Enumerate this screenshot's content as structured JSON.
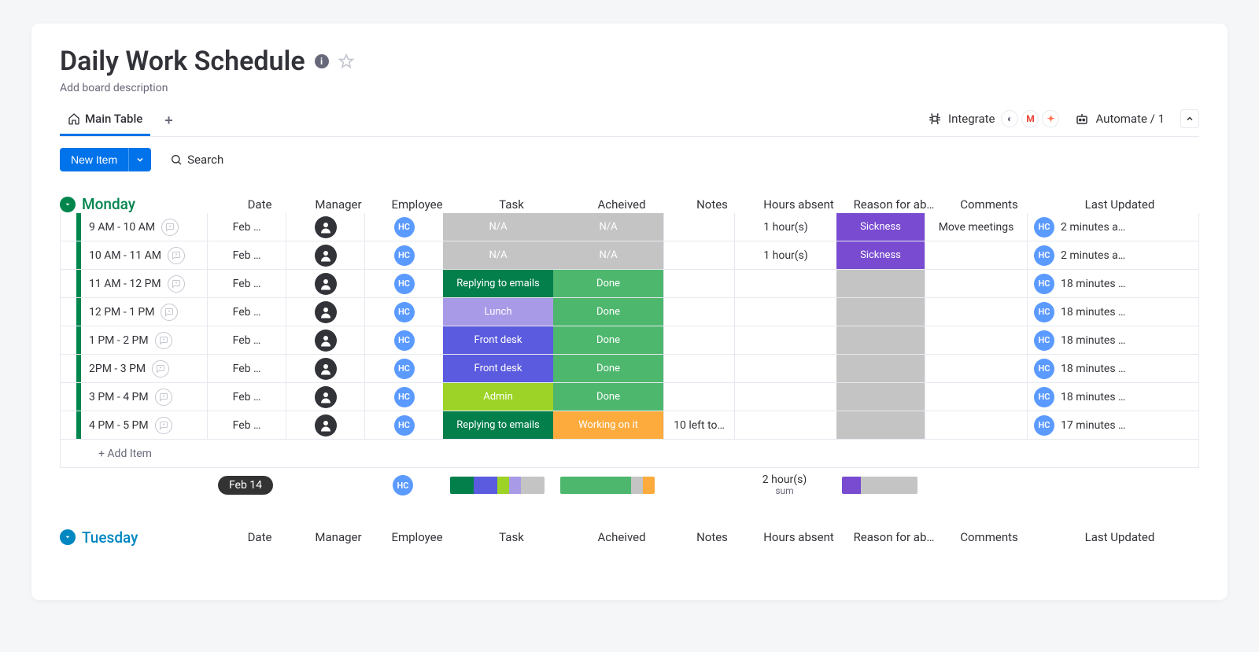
{
  "header": {
    "title": "Daily Work Schedule",
    "description": "Add board description"
  },
  "tabs": {
    "main": "Main Table",
    "integrate": "Integrate",
    "automate": "Automate / 1"
  },
  "toolbar": {
    "new_item": "New Item",
    "search": "Search"
  },
  "columns": [
    "Date",
    "Manager",
    "Employee",
    "Task",
    "Acheived",
    "Notes",
    "Hours absent",
    "Reason for ab…",
    "Comments",
    "Last Updated"
  ],
  "groups": [
    {
      "name": "Monday",
      "color": "#00854d",
      "rows": [
        {
          "name": "9 AM - 10 AM",
          "date": "Feb …",
          "task": {
            "label": "N/A",
            "color": "#c4c4c4"
          },
          "ach": {
            "label": "N/A",
            "color": "#c4c4c4"
          },
          "notes": "",
          "hours": "1 hour(s)",
          "reason": {
            "label": "Sickness",
            "color": "#784bd1"
          },
          "comments": "Move meetings",
          "updated": "2 minutes a…"
        },
        {
          "name": "10 AM - 11 AM",
          "date": "Feb …",
          "task": {
            "label": "N/A",
            "color": "#c4c4c4"
          },
          "ach": {
            "label": "N/A",
            "color": "#c4c4c4"
          },
          "notes": "",
          "hours": "1 hour(s)",
          "reason": {
            "label": "Sickness",
            "color": "#784bd1"
          },
          "comments": "",
          "updated": "2 minutes a…"
        },
        {
          "name": "11 AM - 12 PM",
          "date": "Feb …",
          "task": {
            "label": "Replying to emails",
            "color": "#037f4c"
          },
          "ach": {
            "label": "Done",
            "color": "#4eb76e"
          },
          "notes": "",
          "hours": "",
          "reason": {
            "label": "",
            "color": "#c4c4c4"
          },
          "comments": "",
          "updated": "18 minutes …"
        },
        {
          "name": "12 PM - 1 PM",
          "date": "Feb …",
          "task": {
            "label": "Lunch",
            "color": "#a99ae8"
          },
          "ach": {
            "label": "Done",
            "color": "#4eb76e"
          },
          "notes": "",
          "hours": "",
          "reason": {
            "label": "",
            "color": "#c4c4c4"
          },
          "comments": "",
          "updated": "18 minutes …"
        },
        {
          "name": "1 PM - 2 PM",
          "date": "Feb …",
          "task": {
            "label": "Front desk",
            "color": "#5b5bdf"
          },
          "ach": {
            "label": "Done",
            "color": "#4eb76e"
          },
          "notes": "",
          "hours": "",
          "reason": {
            "label": "",
            "color": "#c4c4c4"
          },
          "comments": "",
          "updated": "18 minutes …"
        },
        {
          "name": "2PM - 3 PM",
          "date": "Feb …",
          "task": {
            "label": "Front desk",
            "color": "#5b5bdf"
          },
          "ach": {
            "label": "Done",
            "color": "#4eb76e"
          },
          "notes": "",
          "hours": "",
          "reason": {
            "label": "",
            "color": "#c4c4c4"
          },
          "comments": "",
          "updated": "18 minutes …"
        },
        {
          "name": "3 PM - 4 PM",
          "date": "Feb …",
          "task": {
            "label": "Admin",
            "color": "#9cd326"
          },
          "ach": {
            "label": "Done",
            "color": "#4eb76e"
          },
          "notes": "",
          "hours": "",
          "reason": {
            "label": "",
            "color": "#c4c4c4"
          },
          "comments": "",
          "updated": "18 minutes …"
        },
        {
          "name": "4 PM - 5 PM",
          "date": "Feb …",
          "task": {
            "label": "Replying to emails",
            "color": "#037f4c"
          },
          "ach": {
            "label": "Working on it",
            "color": "#fdab3d"
          },
          "notes": "10 left to…",
          "hours": "",
          "reason": {
            "label": "",
            "color": "#c4c4c4"
          },
          "comments": "",
          "updated": "17 minutes …"
        }
      ],
      "add_item": "+ Add Item",
      "summary": {
        "date": "Feb 14",
        "hours": "2 hour(s)",
        "hours_sub": "sum",
        "task_bars": [
          {
            "color": "#037f4c",
            "pct": 25
          },
          {
            "color": "#5b5bdf",
            "pct": 25
          },
          {
            "color": "#9cd326",
            "pct": 12.5
          },
          {
            "color": "#a99ae8",
            "pct": 12.5
          },
          {
            "color": "#c4c4c4",
            "pct": 25
          }
        ],
        "ach_bars": [
          {
            "color": "#4eb76e",
            "pct": 75
          },
          {
            "color": "#c4c4c4",
            "pct": 12.5
          },
          {
            "color": "#fdab3d",
            "pct": 12.5
          }
        ],
        "reason_bars": [
          {
            "color": "#784bd1",
            "pct": 25
          },
          {
            "color": "#c4c4c4",
            "pct": 75
          }
        ]
      }
    },
    {
      "name": "Tuesday",
      "color": "#0086c0"
    }
  ],
  "hc_label": "HC"
}
